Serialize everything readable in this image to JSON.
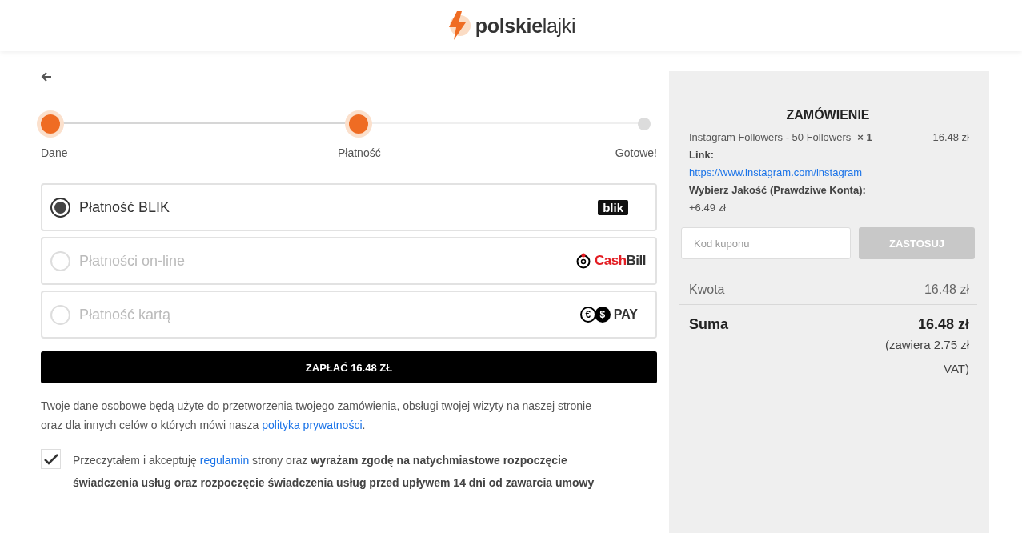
{
  "brand": {
    "name": "**polskie**lajki"
  },
  "steps": [
    {
      "label": "Dane",
      "reached": true
    },
    {
      "label": "Płatność",
      "reached": true
    },
    {
      "label": "Gotowe!",
      "reached": false
    }
  ],
  "payment_methods": [
    {
      "label": "Płatność BLIK",
      "selected": true,
      "logo": {
        "kind": "blik",
        "parts": [
          "blik"
        ]
      }
    },
    {
      "label": "Płatności on-line",
      "selected": false,
      "logo": {
        "kind": "cashbill",
        "parts": [
          "Cash",
          "Bill"
        ]
      }
    },
    {
      "label": "Płatność kartą",
      "selected": false,
      "logo": {
        "kind": "pay",
        "parts": [
          "€",
          "$",
          "PAY"
        ]
      }
    }
  ],
  "pay_button": "ZAPŁAĆ 16.48 ZŁ",
  "privacy": {
    "before": "Twoje dane osobowe będą użyte do przetworzenia twojego zamówienia, obsługi twojej wizyty na naszej stronie oraz dla innych celów o których mówi nasza ",
    "link": "polityka prywatności",
    "after": "."
  },
  "consent": {
    "checked": true,
    "before": "Przeczytałem i akceptuję ",
    "link": "regulamin",
    "after": " strony oraz **wyrażam zgodę na natychmiastowe rozpoczęcie świadczenia usług oraz rozpoczęcie świadczenia usług przed upływem 14 dni od zawarcia umowy**"
  },
  "order": {
    "title": "ZAMÓWIENIE",
    "item": {
      "name": "Instagram Followers - 50 Followers",
      "qty": "× 1",
      "price": "16.48 zł"
    },
    "meta": [
      {
        "label": "Link:",
        "value": "https://www.instagram.com/instagram",
        "kind": "link"
      },
      {
        "label": "Wybierz Jakość (Prawdziwe Konta):",
        "value": "+6.49 zł",
        "kind": "text"
      }
    ],
    "coupon": {
      "placeholder": "Kod kuponu",
      "button": "ZASTOSUJ"
    },
    "subtotal": {
      "label": "Kwota",
      "value": "16.48 zł"
    },
    "total": {
      "label": "Suma",
      "value": "16.48 zł",
      "note": "(zawiera 2.75 zł VAT)"
    }
  }
}
